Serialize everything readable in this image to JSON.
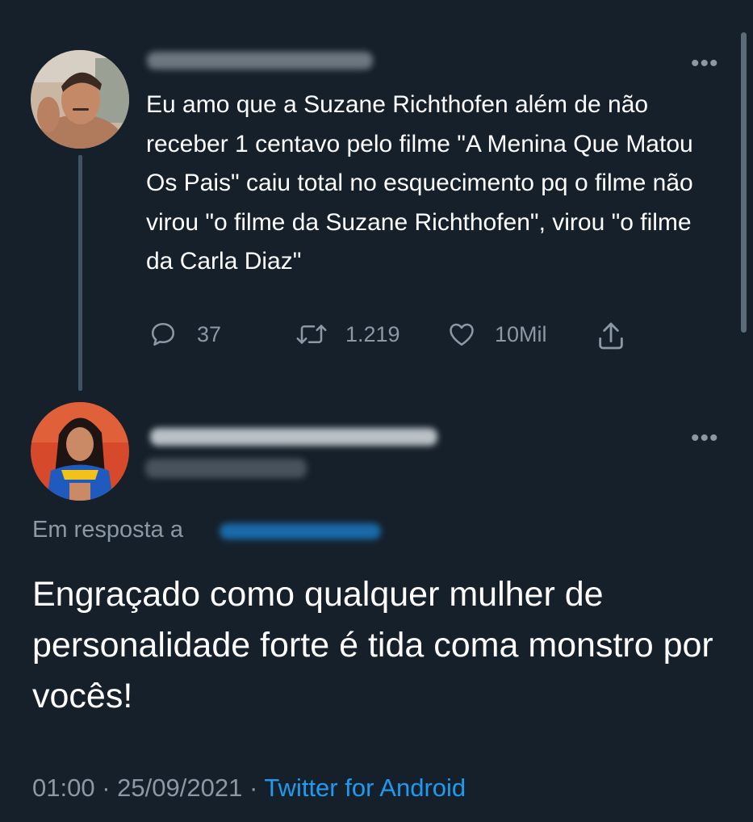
{
  "tweet1": {
    "text": "Eu amo que a Suzane Richthofen além de não receber 1 centavo pelo filme \"A Menina Que Matou Os Pais\" caiu total no esquecimento pq o filme não virou \"o filme da Suzane Richthofen\", virou \"o filme da Carla Diaz\"",
    "more_label": "•••",
    "actions": {
      "replies": "37",
      "retweets": "1.219",
      "likes": "10Mil"
    }
  },
  "tweet2": {
    "more_label": "•••",
    "reply_prefix": "Em resposta a",
    "text": "Engraçado como qualquer mulher de personalidade forte é tida coma monstro por vocês!",
    "time": "01:00",
    "separator": "·",
    "date": "25/09/2021",
    "source": "Twitter for Android"
  },
  "colors": {
    "background": "#15202b",
    "text": "#ffffff",
    "muted": "#8b98a5",
    "accent": "#1d9bf0",
    "thread_line": "#3d5466"
  },
  "icons": [
    "reply-icon",
    "retweet-icon",
    "like-icon",
    "share-icon",
    "more-icon"
  ]
}
